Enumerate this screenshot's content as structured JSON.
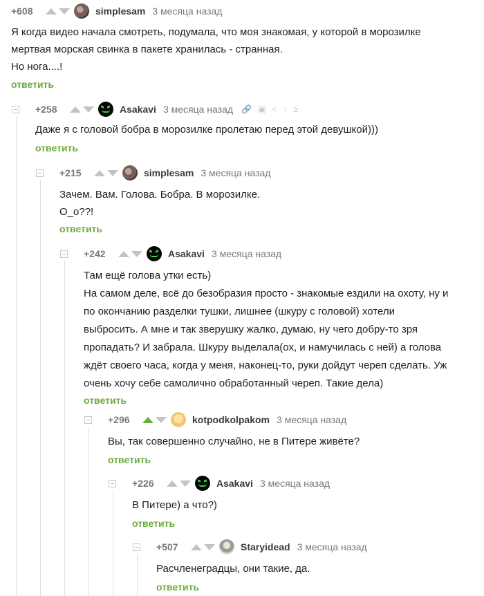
{
  "reply_label": "ответить",
  "comments": [
    {
      "rating": "+608",
      "username": "simplesam",
      "time": "3 месяца назад",
      "lines": [
        "Я когда видео начала смотреть, подумала, что моя знакомая, у которой в морозилке",
        "мертвая морская свинка в пакете хранилась - странная.",
        "Но нога....!"
      ]
    },
    {
      "rating": "+258",
      "username": "Asakavi",
      "time": "3 месяца назад",
      "lines": [
        "Даже я с головой бобра в морозилке пролетаю перед этой девушкой)))"
      ]
    },
    {
      "rating": "+215",
      "username": "simplesam",
      "time": "3 месяца назад",
      "lines": [
        "Зачем. Вам. Голова. Бобра. В морозилке.",
        "О_о??!"
      ]
    },
    {
      "rating": "+242",
      "username": "Asakavi",
      "time": "3 месяца назад",
      "lines": [
        "Там ещё голова утки есть)",
        "На самом деле, всё до безобразия просто - знакомые ездили на охоту, ну и",
        "по окончанию разделки тушки, лишнее (шкуру с головой) хотели",
        "выбросить. А мне и так зверушку жалко, думаю, ну чего добру-то зря",
        "пропадать? И забрала. Шкуру выделала(ох, и намучилась с ней) а голова",
        "ждёт своего часа, когда у меня, наконец-то, руки дойдут череп сделать. Уж",
        "очень хочу себе самолично обработанный череп. Такие дела)"
      ]
    },
    {
      "rating": "+296",
      "username": "kotpodkolpakom",
      "time": "3 месяца назад",
      "lines": [
        "Вы, так совершенно случайно, не в Питере живёте?"
      ]
    },
    {
      "rating": "+226",
      "username": "Asakavi",
      "time": "3 месяца назад",
      "lines": [
        "В Питере) а что?)"
      ]
    },
    {
      "rating": "+507",
      "username": "Staryidead",
      "time": "3 месяца назад",
      "lines": [
        "Расчленеградцы, они такие, да."
      ]
    }
  ]
}
